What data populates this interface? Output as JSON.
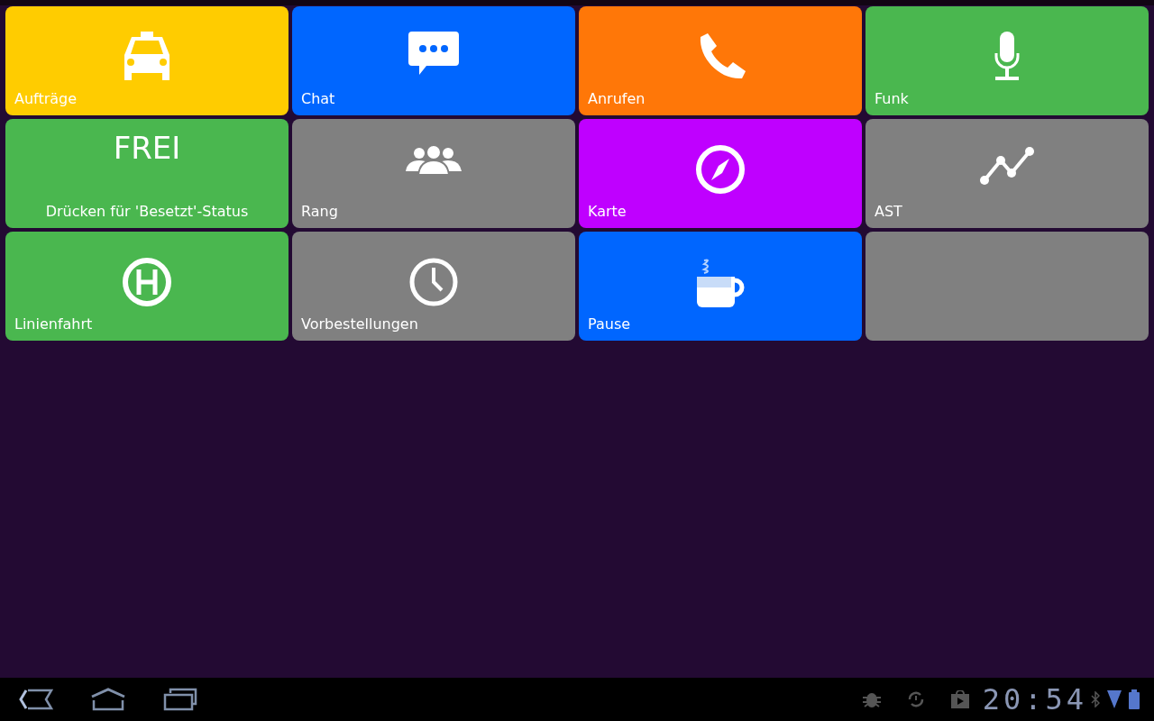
{
  "tiles": [
    {
      "kind": "icon",
      "label": "Aufträge",
      "color": "#ffcc00"
    },
    {
      "kind": "icon",
      "label": "Chat",
      "color": "#0066ff"
    },
    {
      "kind": "icon",
      "label": "Anrufen",
      "color": "#ff7708"
    },
    {
      "kind": "icon",
      "label": "Funk",
      "color": "#4ab74f"
    },
    {
      "kind": "status",
      "title": "FREI",
      "label": "Drücken für 'Besetzt'-Status",
      "color": "#4ab74f"
    },
    {
      "kind": "icon",
      "label": "Rang",
      "color": "#808080"
    },
    {
      "kind": "icon",
      "label": "Karte",
      "color": "#bf00ff"
    },
    {
      "kind": "icon",
      "label": "AST",
      "color": "#808080"
    },
    {
      "kind": "icon",
      "label": "Linienfahrt",
      "color": "#4ab74f"
    },
    {
      "kind": "icon",
      "label": "Vorbestellungen",
      "color": "#808080"
    },
    {
      "kind": "icon",
      "label": "Pause",
      "color": "#0066ff"
    },
    {
      "kind": "empty",
      "color": "#808080"
    }
  ],
  "status_bar": {
    "clock": "20:54"
  }
}
